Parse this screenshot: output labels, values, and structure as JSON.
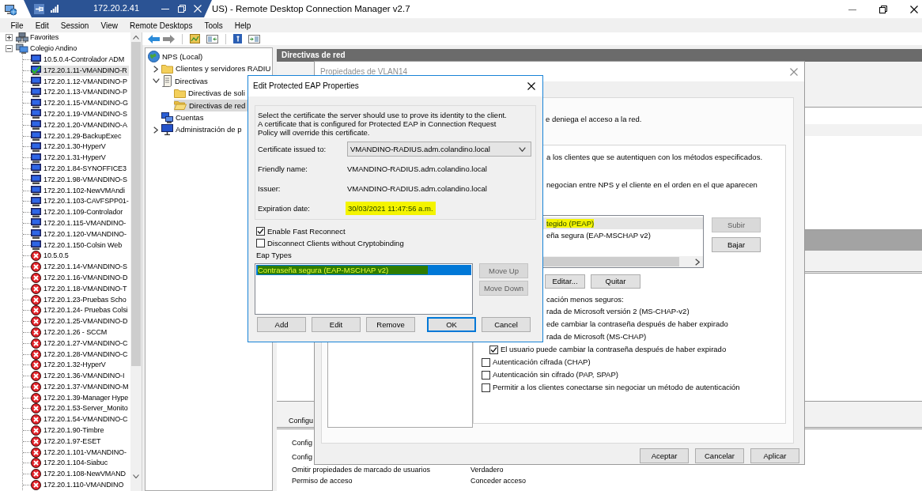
{
  "window": {
    "title": "US) - Remote Desktop Connection Manager v2.7"
  },
  "connection_bar": {
    "address": "172.20.2.41"
  },
  "menu": [
    "File",
    "Edit",
    "Session",
    "View",
    "Remote Desktops",
    "Tools",
    "Help"
  ],
  "server_tree": [
    {
      "label": "Favorites",
      "kind": "favorites",
      "expanded": false,
      "selected": false
    },
    {
      "label": "Colegio Andino",
      "kind": "group",
      "expanded": true,
      "selected": false,
      "children": [
        {
          "label": "10.5.0.4-Controlador ADM",
          "kind": "normal",
          "selected": false
        },
        {
          "label": "172.20.1.11-VMANDINO-R",
          "kind": "connected",
          "selected": true
        },
        {
          "label": "172.20.1.12-VMANDINO-P",
          "kind": "normal",
          "selected": false
        },
        {
          "label": "172.20.1.13-VMANDINO-P",
          "kind": "normal",
          "selected": false
        },
        {
          "label": "172.20.1.15-VMANDINO-G",
          "kind": "normal",
          "selected": false
        },
        {
          "label": "172.20.1.19-VMANDINO-S",
          "kind": "normal",
          "selected": false
        },
        {
          "label": "172.20.1.20-VMANDINO-A",
          "kind": "normal",
          "selected": false
        },
        {
          "label": "172.20.1.29-BackupExec",
          "kind": "normal",
          "selected": false
        },
        {
          "label": "172.20.1.30-HyperV",
          "kind": "normal",
          "selected": false
        },
        {
          "label": "172.20.1.31-HyperV",
          "kind": "normal",
          "selected": false
        },
        {
          "label": "172.20.1.84-SYNOFFICE3",
          "kind": "normal",
          "selected": false
        },
        {
          "label": "172.20.1.98-VMANDINO-S",
          "kind": "normal",
          "selected": false
        },
        {
          "label": "172.20.1.102-NewVMAndi",
          "kind": "normal",
          "selected": false
        },
        {
          "label": "172.20.1.103-CAVFSPP01-",
          "kind": "normal",
          "selected": false
        },
        {
          "label": "172.20.1.109-Controlador",
          "kind": "normal",
          "selected": false
        },
        {
          "label": "172.20.1.115-VMANDINO-",
          "kind": "normal",
          "selected": false
        },
        {
          "label": "172.20.1.120-VMANDINO-",
          "kind": "normal",
          "selected": false
        },
        {
          "label": "172.20.1.150-Colsin Web",
          "kind": "normal",
          "selected": false
        },
        {
          "label": "10.5.0.5",
          "kind": "error",
          "selected": false
        },
        {
          "label": "172.20.1.14-VMANDINO-S",
          "kind": "error",
          "selected": false
        },
        {
          "label": "172.20.1.16-VMANDINO-D",
          "kind": "error",
          "selected": false
        },
        {
          "label": "172.20.1.18-VMANDINO-T",
          "kind": "error",
          "selected": false
        },
        {
          "label": "172.20.1.23-Pruebas Scho",
          "kind": "error",
          "selected": false
        },
        {
          "label": "172.20.1.24- Pruebas Colsi",
          "kind": "error",
          "selected": false
        },
        {
          "label": "172.20.1.25-VMANDINO-D",
          "kind": "error",
          "selected": false
        },
        {
          "label": "172.20.1.26 - SCCM",
          "kind": "error",
          "selected": false
        },
        {
          "label": "172.20.1.27-VMANDINO-C",
          "kind": "error",
          "selected": false
        },
        {
          "label": "172.20.1.28-VMANDINO-C",
          "kind": "error",
          "selected": false
        },
        {
          "label": "172.20.1.32-HyperV",
          "kind": "error",
          "selected": false
        },
        {
          "label": "172.20.1.36-VMANDINO-I",
          "kind": "error",
          "selected": false
        },
        {
          "label": "172.20.1.37-VMANDINO-M",
          "kind": "error",
          "selected": false
        },
        {
          "label": "172.20.1.39-Manager Hype",
          "kind": "error",
          "selected": false
        },
        {
          "label": "172.20.1.53-Server_Monito",
          "kind": "error",
          "selected": false
        },
        {
          "label": "172.20.1.54-VMANDINO-C",
          "kind": "error",
          "selected": false
        },
        {
          "label": "172.20.1.90-Timbre",
          "kind": "error",
          "selected": false
        },
        {
          "label": "172.20.1.97-ESET",
          "kind": "error",
          "selected": false
        },
        {
          "label": "172.20.1.101-VMANDINO-",
          "kind": "error",
          "selected": false
        },
        {
          "label": "172.20.1.104-Siabuc",
          "kind": "error",
          "selected": false
        },
        {
          "label": "172.20.1.108-NewVMAND",
          "kind": "error",
          "selected": false
        },
        {
          "label": "172.20.1.110-VMANDINO",
          "kind": "error",
          "selected": false
        }
      ]
    }
  ],
  "nps": {
    "tree": [
      {
        "label": "NPS (Local)",
        "kind": "globe",
        "selected": false,
        "children": [
          {
            "label": "Clientes y servidores RADIU",
            "kind": "folder",
            "expanded": false,
            "selected": false
          },
          {
            "label": "Directivas",
            "kind": "document",
            "expanded": true,
            "selected": false,
            "children": [
              {
                "label": "Directivas de soli",
                "kind": "folder",
                "selected": false
              },
              {
                "label": "Directivas de red",
                "kind": "folder",
                "selected": true
              }
            ]
          },
          {
            "label": "Cuentas",
            "kind": "computers",
            "selected": false
          },
          {
            "label": "Administración de p",
            "kind": "computer",
            "expanded": false,
            "selected": false
          }
        ]
      }
    ],
    "header": "Directivas de red",
    "settings_title": "Configu",
    "settings": [
      {
        "kind": "group",
        "name": "Config"
      },
      {
        "kind": "group",
        "name": "Config"
      },
      {
        "kind": "setting",
        "name": "Omitir propiedades de marcado de usuarios",
        "value": "Verdadero"
      },
      {
        "kind": "setting",
        "name": "Permiso de acceso",
        "value": "Conceder acceso"
      }
    ]
  },
  "vlan_dialog": {
    "title": "Propiedades de VLAN14",
    "notice": "e deniega el acceso a la red.",
    "lines": [
      "a los clientes que se autentiquen con los métodos especificados.",
      "negocian entre NPS y el cliente en el orden en el que aparecen"
    ],
    "eap_list": [
      {
        "label": "tegido (PEAP)",
        "selected": true,
        "highlighted": true
      },
      {
        "label": "eña segura (EAP-MSCHAP v2)",
        "selected": false,
        "highlighted": false
      }
    ],
    "order_buttons": [
      {
        "label": "Subir",
        "disabled": true
      },
      {
        "label": "Bajar",
        "disabled": false
      }
    ],
    "list_buttons": [
      {
        "label": "Editar..."
      },
      {
        "label": "Quitar"
      }
    ],
    "less_secure_label": "cación menos seguros:",
    "auth_methods": [
      {
        "kind": "text",
        "label": "rada de Microsoft versión 2 (MS-CHAP-v2)",
        "children": [
          {
            "kind": "text",
            "label": "ede cambiar la contraseña después de haber expirado"
          }
        ]
      },
      {
        "kind": "text",
        "label": "rada de Microsoft (MS-CHAP)",
        "children": [
          {
            "kind": "checkbox",
            "label": "El usuario puede cambiar la contraseña después de haber expirado",
            "checked": true
          }
        ]
      },
      {
        "kind": "checkbox",
        "label": "Autenticación cifrada (CHAP)",
        "checked": false
      },
      {
        "kind": "checkbox",
        "label": "Autenticación sin cifrado (PAP, SPAP)",
        "checked": false
      },
      {
        "kind": "checkbox",
        "label": "Permitir a los clientes conectarse sin negociar un método de autenticación",
        "checked": false
      }
    ],
    "buttons": [
      {
        "label": "Aceptar"
      },
      {
        "label": "Cancelar"
      },
      {
        "label": "Aplicar"
      }
    ]
  },
  "eap_dialog": {
    "title": "Edit Protected EAP Properties",
    "intro": "Select the certificate the server should use to prove its identity to the client. A certificate that is configured for Protected EAP in Connection Request Policy will override this certificate.",
    "fields": [
      {
        "label": "Certificate issued to:",
        "value": "VMANDINO-RADIUS.adm.colandino.local",
        "kind": "dropdown",
        "highlighted": false
      },
      {
        "label": "Friendly name:",
        "value": "VMANDINO-RADIUS.adm.colandino.local",
        "kind": "text",
        "highlighted": false
      },
      {
        "label": "Issuer:",
        "value": "VMANDINO-RADIUS.adm.colandino.local",
        "kind": "text",
        "highlighted": false
      },
      {
        "label": "Expiration date:",
        "value": "30/03/2021 11:47:56 a.m.",
        "kind": "text",
        "highlighted": true
      }
    ],
    "options": [
      {
        "label": "Enable Fast Reconnect",
        "checked": true
      },
      {
        "label": "Disconnect Clients without Cryptobinding",
        "checked": false
      }
    ],
    "eap_types_label": "Eap Types",
    "eap_types": [
      {
        "label": "Contraseña segura (EAP-MSCHAP v2)",
        "selected": true,
        "highlighted": true
      }
    ],
    "order_buttons": [
      {
        "label": "Move Up",
        "disabled": true
      },
      {
        "label": "Move Down",
        "disabled": true
      }
    ],
    "buttons": [
      {
        "label": "Add",
        "default": false
      },
      {
        "label": "Edit",
        "default": false
      },
      {
        "label": "Remove",
        "default": false
      },
      {
        "label": "OK",
        "default": true
      },
      {
        "label": "Cancel",
        "default": false
      }
    ]
  }
}
